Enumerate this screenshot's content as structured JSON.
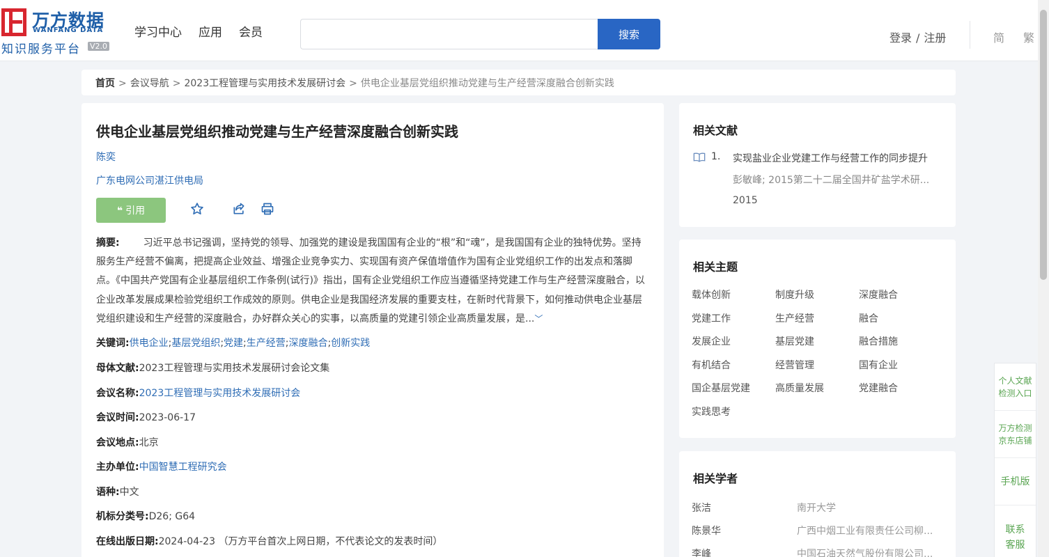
{
  "logo": {
    "cn": "万方数据",
    "en": "WANFANG DATA",
    "sub": "知识服务平台",
    "version": "V2.0"
  },
  "nav": [
    "学习中心",
    "应用",
    "会员"
  ],
  "search": {
    "placeholder": "",
    "button": "搜索"
  },
  "account": {
    "login": "登录",
    "sep": "/",
    "register": "注册"
  },
  "lang": {
    "simplified": "简",
    "traditional": "繁"
  },
  "breadcrumb": {
    "home": "首页",
    "sep": ">",
    "items": [
      "会议导航",
      "2023工程管理与实用技术发展研讨会"
    ],
    "current": "供电企业基层党组织推动党建与生产经营深度融合创新实践"
  },
  "paper": {
    "title": "供电企业基层党组织推动党建与生产经营深度融合创新实践",
    "author": "陈奕",
    "org": "广东电网公司湛江供电局",
    "cite_label": "引用",
    "abstract_label": "摘要:",
    "abstract": "习近平总书记强调，坚持党的领导、加强党的建设是我国国有企业的“根”和“魂”，是我国国有企业的独特优势。坚持服务生产经营不偏离，把提高企业效益、增强企业竞争实力、实现国有资产保值增值作为国有企业党组织工作的出发点和落脚点。《中国共产党国有企业基层组织工作条例(试行)》指出，国有企业党组织工作应当遵循坚持党建工作与生产经营深度融合，以企业改革发展成果检验党组织工作成效的原则。供电企业是我国经济发展的重要支柱，在新时代背景下，如何推动供电企业基层党组织建设和生产经营的深度融合，办好群众关心的实事，以高质量的党建引领企业高质量发展，是...",
    "keywords_label": "关键词:",
    "keywords": [
      "供电企业",
      "基层党组织",
      "党建",
      "生产经营",
      "深度融合",
      "创新实践"
    ],
    "keyword_sep": ";",
    "parent_label": "母体文献:",
    "parent": "2023工程管理与实用技术发展研讨会论文集",
    "conf_name_label": "会议名称:",
    "conf_name": "2023工程管理与实用技术发展研讨会",
    "conf_time_label": "会议时间:",
    "conf_time": "2023-06-17",
    "conf_place_label": "会议地点:",
    "conf_place": "北京",
    "host_label": "主办单位:",
    "host": "中国智慧工程研究会",
    "lang_label": "语种:",
    "lang": "中文",
    "class_label": "机标分类号:",
    "class": "D26; G64",
    "online_label": "在线出版日期:",
    "online": "2024-04-23",
    "online_note": "（万方平台首次上网日期，不代表论文的发表时间）"
  },
  "related_lit": {
    "title": "相关文献",
    "items": [
      {
        "num": "1.",
        "title": "实现盐业企业党建工作与经营工作的同步提升",
        "meta": "彭敏峰;  2015第二十二届全国井矿盐学术研...",
        "year": "2015"
      }
    ]
  },
  "related_topics": {
    "title": "相关主题",
    "items": [
      "载体创新",
      "制度升级",
      "深度融合",
      "党建工作",
      "生产经营",
      "融合",
      "发展企业",
      "基层党建",
      "融合措施",
      "有机结合",
      "经营管理",
      "国有企业",
      "国企基层党建",
      "高质量发展",
      "党建融合",
      "实践思考"
    ]
  },
  "related_scholars": {
    "title": "相关学者",
    "items": [
      {
        "name": "张洁",
        "org": "南开大学"
      },
      {
        "name": "陈景华",
        "org": "广西中烟工业有限责任公司柳..."
      },
      {
        "name": "李峰",
        "org": "中国石油天然气股份有限公司..."
      }
    ]
  },
  "rail": {
    "check": [
      "个人文献",
      "检测入口"
    ],
    "store": [
      "万方检测",
      "京东店铺"
    ],
    "mobile": "手机版",
    "service": [
      "联系",
      "客服"
    ]
  },
  "colors": {
    "brand_blue": "#2966c4",
    "link": "#2f6db5",
    "logo_red": "#d8262f",
    "cite_green": "#8cc67e"
  }
}
